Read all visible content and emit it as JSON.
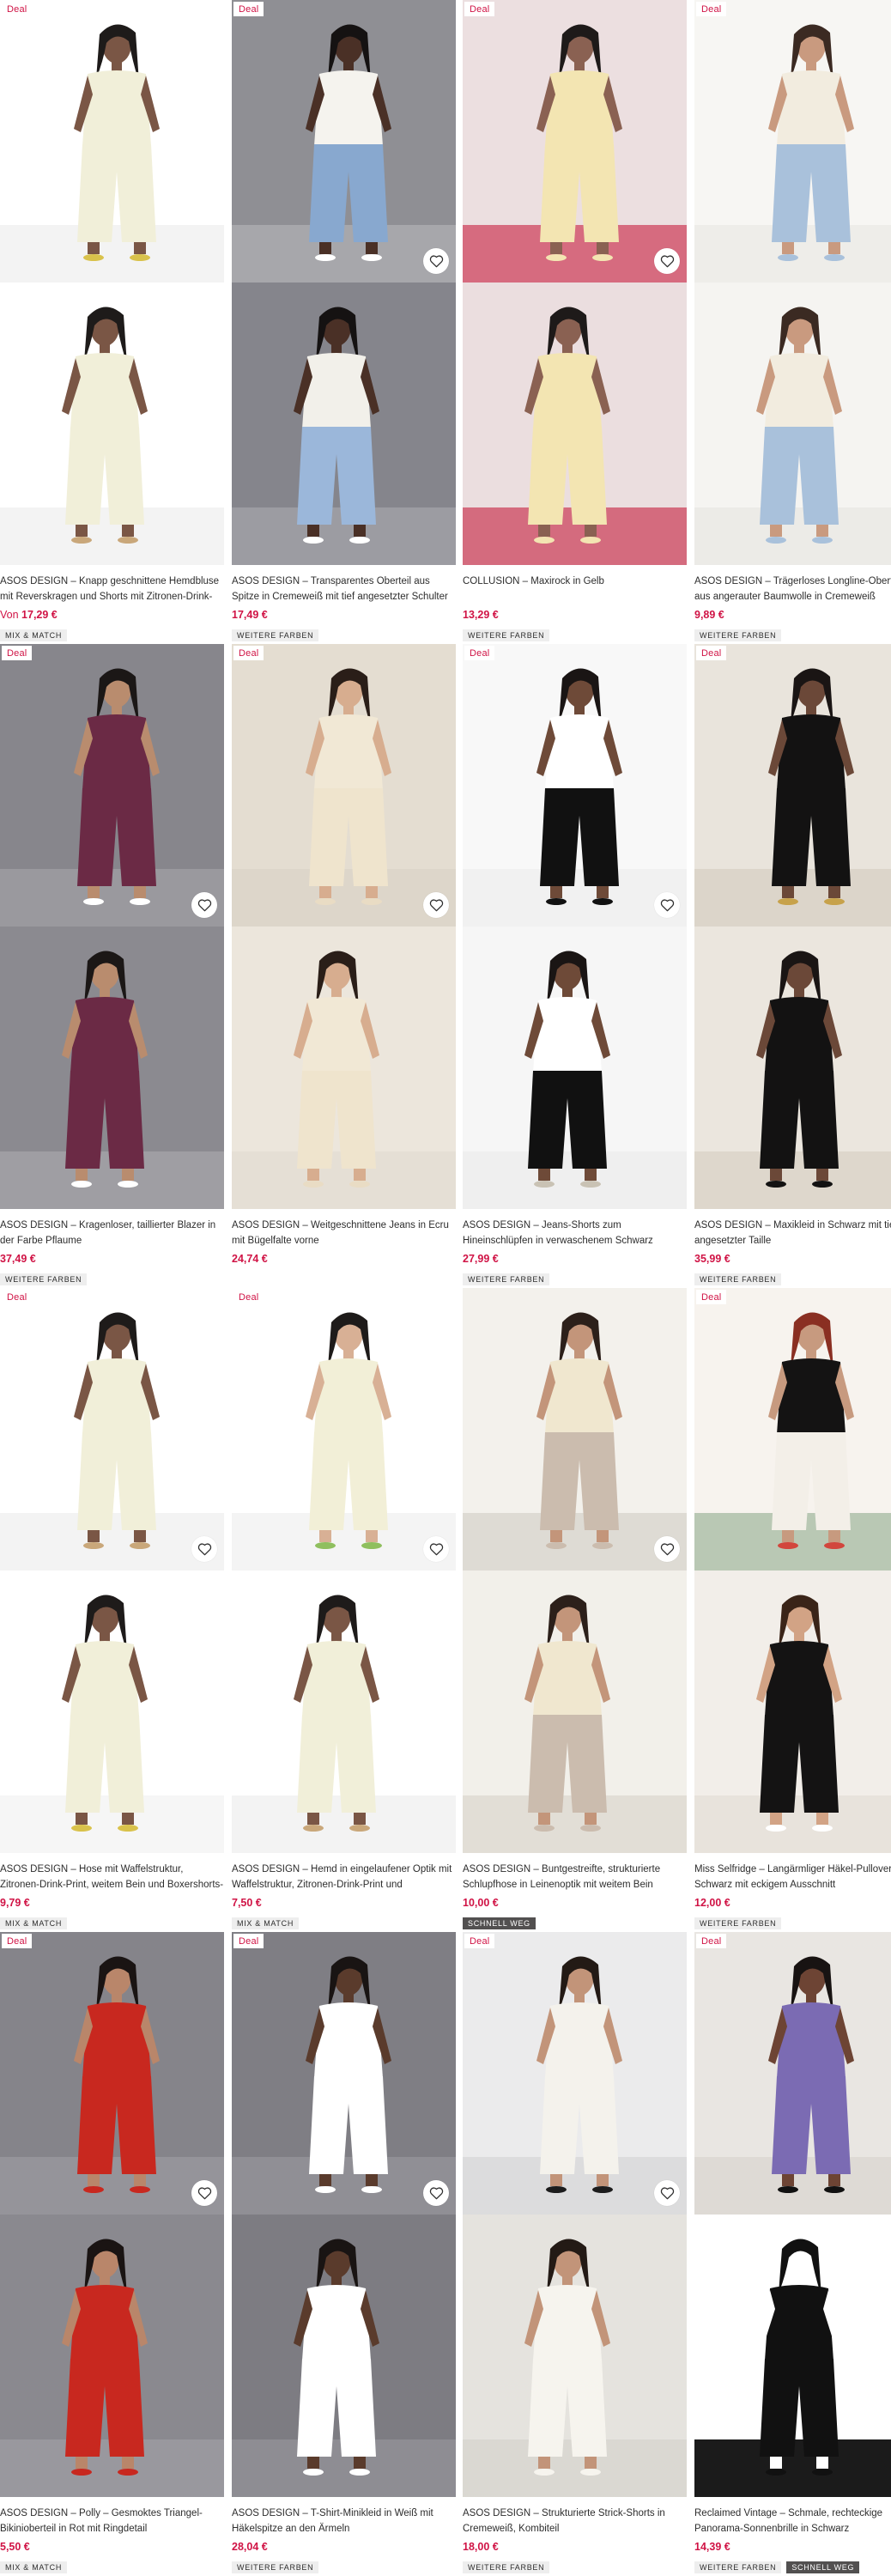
{
  "labels": {
    "deal": "Deal",
    "from": "Von"
  },
  "colors": {
    "accent": "#d01345",
    "tag_bg": "#eeeeee",
    "tag_dark_bg": "#525050",
    "text": "#2d2d2d"
  },
  "icons": {
    "favorite": "heart-outline-icon"
  },
  "products": [
    {
      "title": "ASOS DESIGN – Knapp geschnittene Hemdbluse mit Reverskragen und Shorts mit Zitronen-Drink-Print",
      "price": "17,29 €",
      "price_prefix": "Von",
      "deal": true,
      "favorite_visible": false,
      "tags": [
        "MIX & MATCH"
      ]
    },
    {
      "title": "ASOS DESIGN – Transparentes Oberteil aus Spitze in Cremeweiß mit tief angesetzter Schulter und Schleife",
      "price": "17,49 €",
      "price_prefix": "",
      "deal": true,
      "favorite_visible": true,
      "tags": [
        "WEITERE FARBEN"
      ]
    },
    {
      "title": "COLLUSION – Maxirock in Gelb",
      "price": "13,29 €",
      "price_prefix": "",
      "deal": true,
      "favorite_visible": true,
      "tags": [
        "WEITERE FARBEN"
      ]
    },
    {
      "title": "ASOS DESIGN – Trägerloses Longline-Oberteil aus angerauter Baumwolle in Cremeweiß",
      "price": "9,89 €",
      "price_prefix": "",
      "deal": true,
      "favorite_visible": false,
      "tags": [
        "WEITERE FARBEN"
      ]
    },
    {
      "title": "ASOS DESIGN – Kragenloser, taillierter Blazer in der Farbe Pflaume",
      "price": "37,49 €",
      "price_prefix": "",
      "deal": true,
      "favorite_visible": true,
      "tags": [
        "WEITERE FARBEN"
      ]
    },
    {
      "title": "ASOS DESIGN – Weitgeschnittene Jeans in Ecru mit Bügelfalte vorne",
      "price": "24,74 €",
      "price_prefix": "",
      "deal": true,
      "favorite_visible": true,
      "tags": []
    },
    {
      "title": "ASOS DESIGN – Jeans-Shorts zum Hineinschlüpfen in verwaschenem Schwarz",
      "price": "27,99 €",
      "price_prefix": "",
      "deal": true,
      "favorite_visible": true,
      "tags": [
        "WEITERE FARBEN"
      ]
    },
    {
      "title": "ASOS DESIGN – Maxikleid in Schwarz mit tief angesetzter Taille",
      "price": "35,99 €",
      "price_prefix": "",
      "deal": true,
      "favorite_visible": false,
      "tags": [
        "WEITERE FARBEN"
      ]
    },
    {
      "title": "ASOS DESIGN – Hose mit Waffelstruktur, Zitronen-Drink-Print, weitem Bein und Boxershorts-Bund, Kombiteil",
      "price": "9,79 €",
      "price_prefix": "",
      "deal": true,
      "favorite_visible": true,
      "tags": [
        "MIX & MATCH"
      ]
    },
    {
      "title": "ASOS DESIGN – Hemd in eingelaufener Optik mit Waffelstruktur, Zitronen-Drink-Print und Reverskragen",
      "price": "7,50 €",
      "price_prefix": "",
      "deal": true,
      "favorite_visible": true,
      "tags": [
        "MIX & MATCH"
      ]
    },
    {
      "title": "ASOS DESIGN – Buntgestreifte, strukturierte Schlupfhose in Leinenoptik mit weitem Bein",
      "price": "10,00 €",
      "price_prefix": "",
      "deal": false,
      "favorite_visible": true,
      "tags": [
        "SCHNELL WEG"
      ]
    },
    {
      "title": "Miss Selfridge – Langärmliger Häkel-Pullover in Schwarz mit eckigem Ausschnitt",
      "price": "12,00 €",
      "price_prefix": "",
      "deal": true,
      "favorite_visible": false,
      "tags": [
        "WEITERE FARBEN"
      ]
    },
    {
      "title": "ASOS DESIGN – Polly – Gesmoktes Triangel-Bikinioberteil in Rot mit Ringdetail",
      "price": "5,50 €",
      "price_prefix": "",
      "deal": true,
      "favorite_visible": true,
      "tags": [
        "MIX & MATCH"
      ]
    },
    {
      "title": "ASOS DESIGN – T-Shirt-Minikleid in Weiß mit Häkelspitze an den Ärmeln",
      "price": "28,04 €",
      "price_prefix": "",
      "deal": true,
      "favorite_visible": true,
      "tags": [
        "WEITERE FARBEN"
      ]
    },
    {
      "title": "ASOS DESIGN – Strukturierte Strick-Shorts in Cremeweiß, Kombiteil",
      "price": "18,00 €",
      "price_prefix": "",
      "deal": true,
      "favorite_visible": true,
      "tags": [
        "WEITERE FARBEN"
      ]
    },
    {
      "title": "Reclaimed Vintage – Schmale, rechteckige Panorama-Sonnenbrille in Schwarz",
      "price": "14,39 €",
      "price_prefix": "",
      "deal": true,
      "favorite_visible": false,
      "tags": [
        "WEITERE FARBEN",
        "SCHNELL WEG"
      ]
    }
  ]
}
